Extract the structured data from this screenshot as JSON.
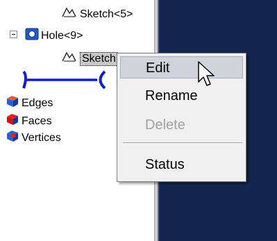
{
  "tree": {
    "items": [
      {
        "label": "Sketch<5>",
        "icon": "sketch-icon"
      },
      {
        "label": "Hole<9>",
        "icon": "hole-feature-icon"
      },
      {
        "label": "Sketch",
        "icon": "sketch-icon",
        "selected": true
      },
      {
        "label": "Edges",
        "icon": "edges-icon"
      },
      {
        "label": "Faces",
        "icon": "faces-icon"
      },
      {
        "label": "Vertices",
        "icon": "vertices-icon"
      }
    ]
  },
  "context_menu": {
    "items": [
      {
        "label": "Edit",
        "state": "highlighted"
      },
      {
        "label": "Rename",
        "state": "enabled"
      },
      {
        "label": "Delete",
        "state": "disabled"
      },
      {
        "label": "Status",
        "state": "enabled"
      }
    ]
  },
  "colors": {
    "viewport_background": "#14264f",
    "menu_highlight": "#cfd3da",
    "disabled_text": "#a0a0a0"
  }
}
